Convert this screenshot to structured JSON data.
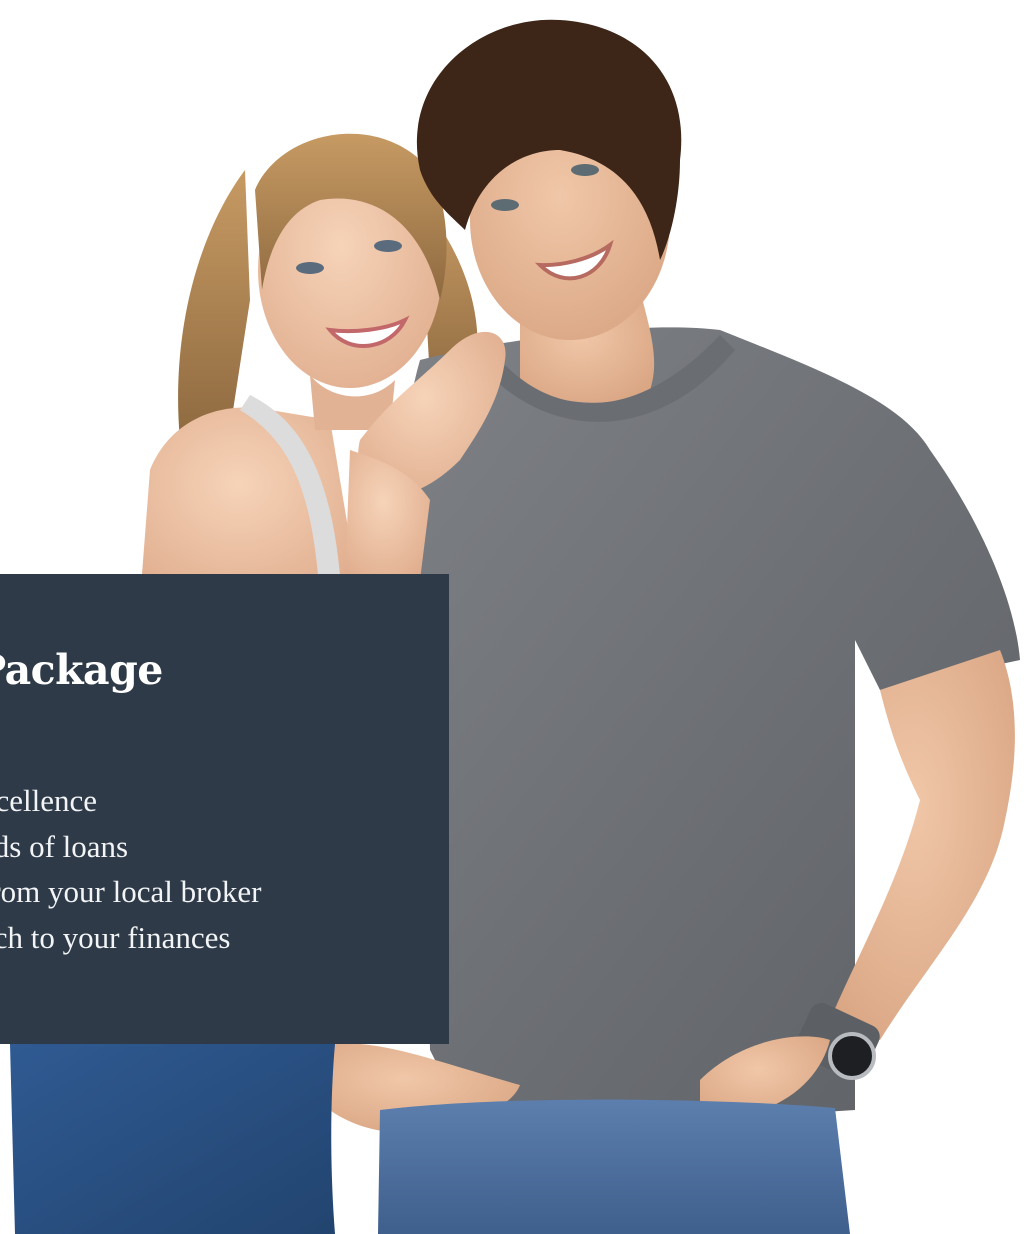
{
  "hero": {
    "image_label": "smiling couple photo",
    "panel_color": "#2e3a48",
    "text_color": "#ffffff"
  },
  "panel": {
    "heading": "e Package",
    "items": [
      "xcellence",
      "eds of loans",
      " from your local broker",
      "ach to your finances"
    ]
  }
}
